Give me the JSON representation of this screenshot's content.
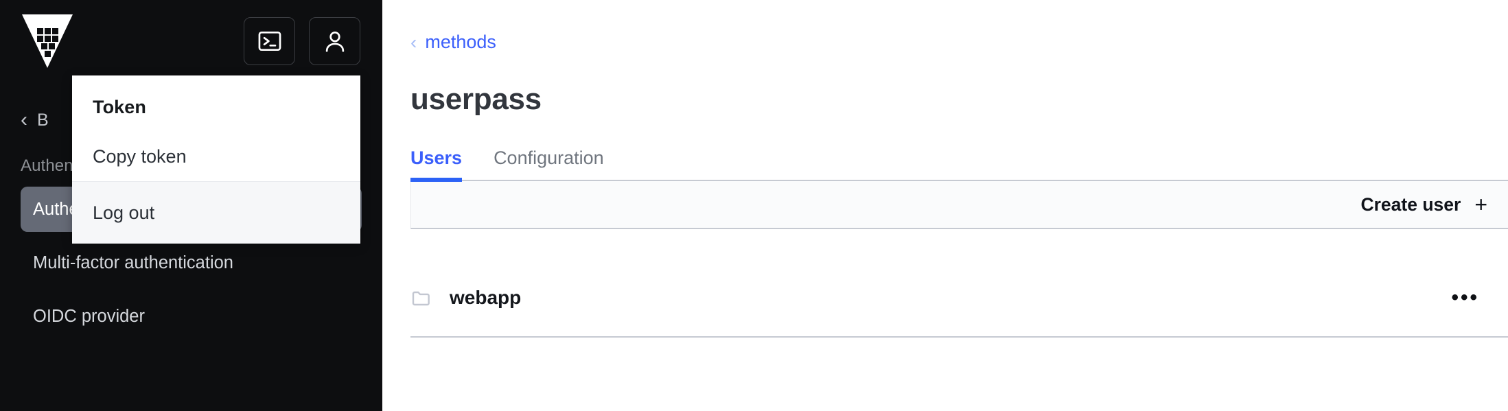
{
  "sidebar": {
    "logo_name": "vault-logo",
    "actions": [
      {
        "name": "console-toggle",
        "icon": "terminal-icon",
        "label": "Console"
      },
      {
        "name": "user-menu-toggle",
        "icon": "user-icon",
        "label": "User"
      }
    ],
    "back": {
      "chevron": "‹",
      "label": "B"
    },
    "section_label": "Authentication",
    "items": [
      {
        "label": "Authentication methods",
        "active": true
      },
      {
        "label": "Multi-factor authentication",
        "active": false
      },
      {
        "label": "OIDC provider",
        "active": false
      }
    ]
  },
  "user_menu": {
    "title": "Token",
    "copy_token": "Copy token",
    "log_out": "Log out"
  },
  "main": {
    "breadcrumb": {
      "chevron": "‹",
      "label": "methods"
    },
    "title": "userpass",
    "tabs": [
      {
        "label": "Users",
        "active": true
      },
      {
        "label": "Configuration",
        "active": false
      }
    ],
    "toolbar": {
      "create_user": "Create user",
      "plus": "+"
    },
    "rows": [
      {
        "label": "webapp",
        "icon": "folder-icon",
        "menu": "•••"
      }
    ]
  },
  "colors": {
    "sidebar_bg": "#0d0e10",
    "nav_active_bg": "#656a76",
    "accent_blue": "#3b5ffb",
    "tab_underline": "#2c62f6",
    "divider": "#c6cad2"
  }
}
